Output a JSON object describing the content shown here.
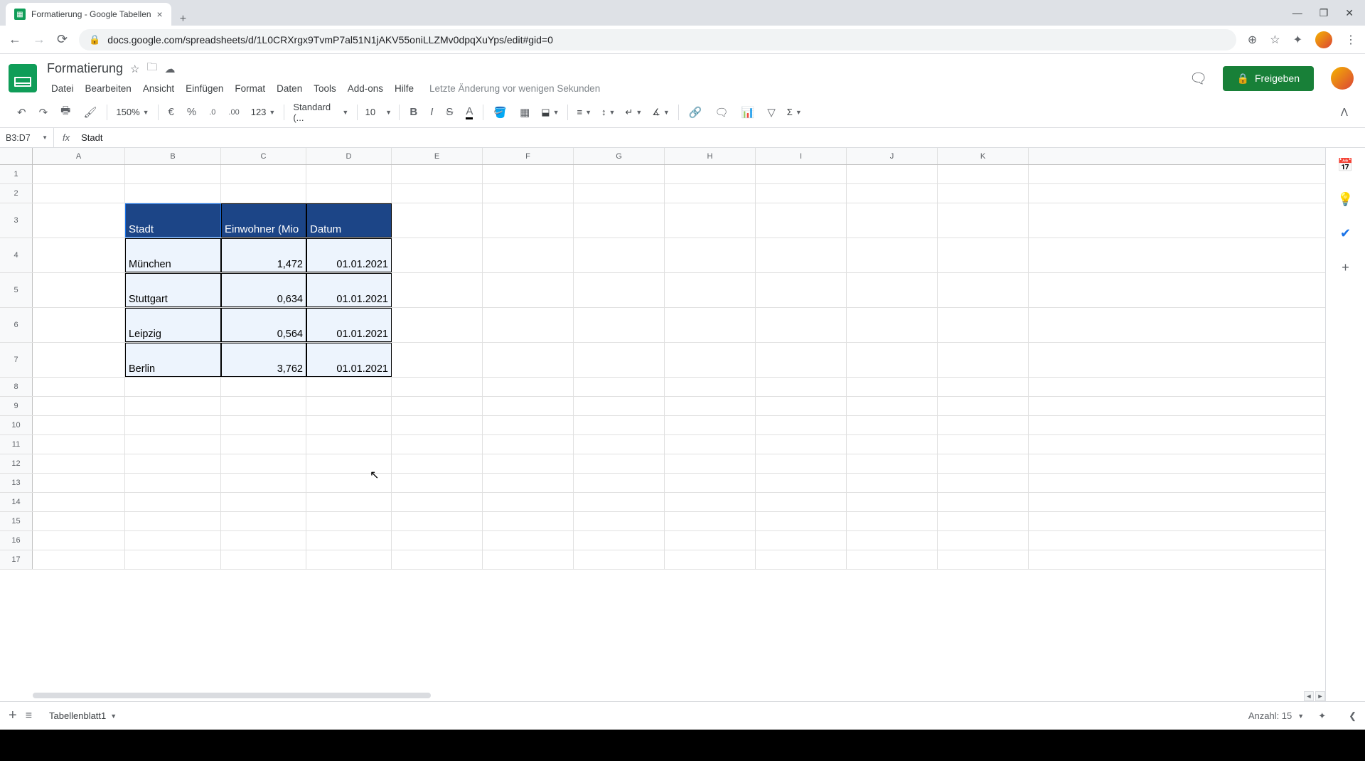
{
  "browser": {
    "tab_title": "Formatierung - Google Tabellen",
    "url": "docs.google.com/spreadsheets/d/1L0CRXrgx9TvmP7al51N1jAKV55oniLLZMv0dpqXuYps/edit#gid=0"
  },
  "doc": {
    "title": "Formatierung",
    "last_edit": "Letzte Änderung vor wenigen Sekunden"
  },
  "menus": {
    "file": "Datei",
    "edit": "Bearbeiten",
    "view": "Ansicht",
    "insert": "Einfügen",
    "format": "Format",
    "data": "Daten",
    "tools": "Tools",
    "addons": "Add-ons",
    "help": "Hilfe"
  },
  "toolbar": {
    "zoom": "150%",
    "currency": "€",
    "percent": "%",
    "dec_dec": ".0",
    "inc_dec": ".00",
    "more_formats": "123",
    "font": "Standard (...",
    "font_size": "10"
  },
  "share": {
    "label": "Freigeben"
  },
  "namebox": {
    "ref": "B3:D7"
  },
  "formula": {
    "value": "Stadt"
  },
  "columns": [
    "A",
    "B",
    "C",
    "D",
    "E",
    "F",
    "G",
    "H",
    "I",
    "J",
    "K"
  ],
  "rows": [
    "1",
    "2",
    "3",
    "4",
    "5",
    "6",
    "7",
    "8",
    "9",
    "10",
    "11",
    "12",
    "13",
    "14",
    "15",
    "16",
    "17"
  ],
  "table": {
    "headers": {
      "b": "Stadt",
      "c": "Einwohner (Mio",
      "d": "Datum"
    },
    "rows": [
      {
        "b": "München",
        "c": "1,472",
        "d": "01.01.2021"
      },
      {
        "b": "Stuttgart",
        "c": "0,634",
        "d": "01.01.2021"
      },
      {
        "b": "Leipzig",
        "c": "0,564",
        "d": "01.01.2021"
      },
      {
        "b": "Berlin",
        "c": "3,762",
        "d": "01.01.2021"
      }
    ]
  },
  "sheet_tab": {
    "name": "Tabellenblatt1"
  },
  "status": {
    "count": "Anzahl: 15"
  }
}
